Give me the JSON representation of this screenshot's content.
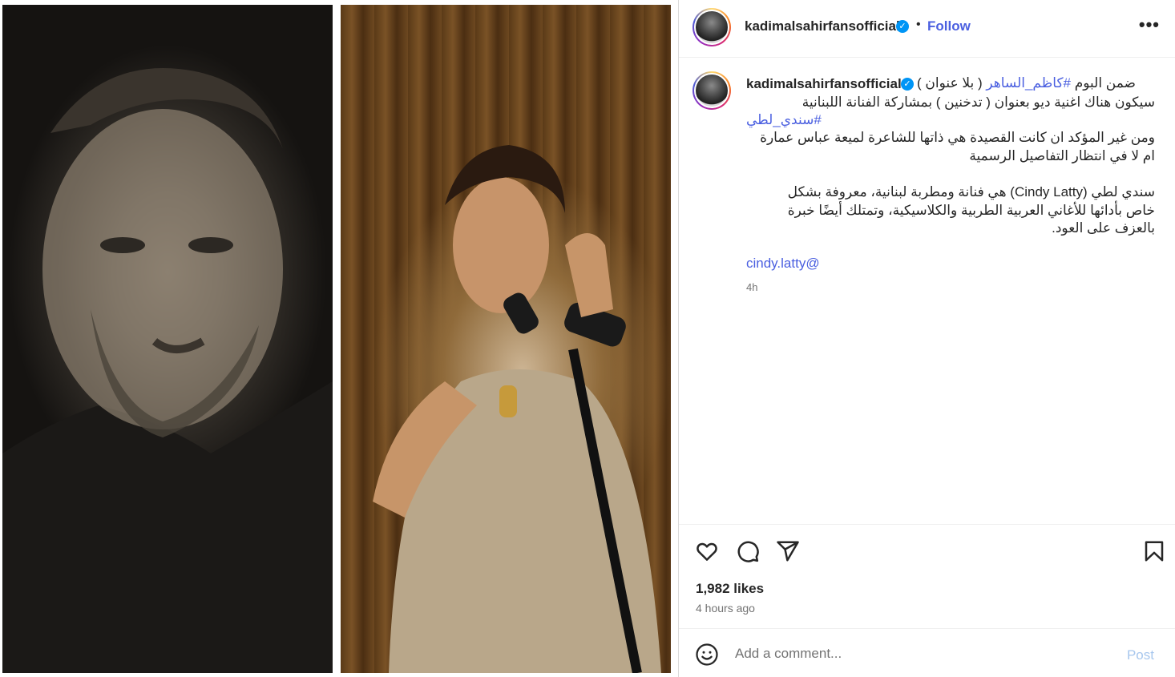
{
  "header": {
    "username": "kadimalsahirfansofficial",
    "verified_icon": "verified-badge-icon",
    "separator": "•",
    "follow_label": "Follow",
    "more_icon": "•••"
  },
  "caption": {
    "username": "kadimalsahirfansofficial",
    "line1_prefix": "ضمن البوم ",
    "line1_tag": "#كاظم_الساهر",
    "line1_suffix": " ( بلا عنوان )",
    "line2": "سيكون هناك اغنية ديو بعنوان ( تدخنين ) بمشاركة الفنانة اللبنانية",
    "line3_tag": "#سندي_لطي",
    "line4": "ومن غير المؤكد ان كانت القصيدة هي ذاتها للشاعرة لميعة عباس عمارة",
    "line5": "ام لا في انتظار التفاصيل الرسمية",
    "line6": "سندي لطي (Cindy Latty) هي فنانة ومطربة لبنانية، معروفة بشكل",
    "line7": "خاص بأدائها للأغاني العربية الطربية والكلاسيكية، وتمتلك أيضًا خبرة",
    "line8": "بالعزف على العود.",
    "mention": "cindy.latty@",
    "time": "4h"
  },
  "actions": {
    "likes": "1,982 likes",
    "posted": "4 hours ago"
  },
  "comment": {
    "placeholder": "Add a comment...",
    "post_label": "Post"
  },
  "colors": {
    "link": "#4a5fe0",
    "verified": "#0095f6",
    "post_disabled": "#a7c7ee"
  }
}
